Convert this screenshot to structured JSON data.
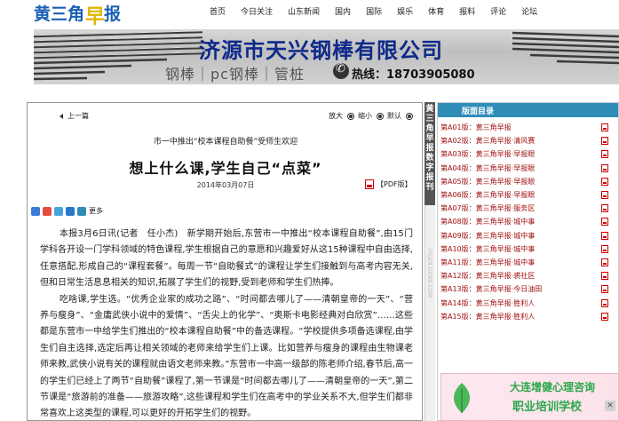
{
  "logo": {
    "part1": "黄三角",
    "mark": "早",
    "part2": "报"
  },
  "nav": [
    "首页",
    "今日关注",
    "山东新闻",
    "国内",
    "国际",
    "娱乐",
    "体育",
    "报料",
    "评论",
    "论坛"
  ],
  "banner": {
    "title": "济源市天兴钢棒有限公司",
    "subtitle": "钢棒｜pc钢棒｜管桩",
    "hotline": "热线：18703905080"
  },
  "article": {
    "prev": "上一篇",
    "zoom_in": "放大",
    "zoom_out": "缩小",
    "default": "默认",
    "kicker": "市一中推出“校本课程自助餐”受师生欢迎",
    "headline": "想上什么课,学生自己“点菜”",
    "date": "2014年03月07日",
    "pdf": "【PDF版】",
    "share_more": "更多",
    "paragraphs": [
      "本报3月6日讯(记者　任小杰)　新学期开始后,东营市一中推出“校本课程自助餐”,由15门学科各开设一门学科领域的特色课程,学生根据自己的意愿和兴趣爱好从这15种课程中自由选择,任意搭配,形成自己的“课程套餐”。每周一节“自助餐式”的课程让学生们接触到与高考内容无关,但和日常生活息息相关的知识,拓展了学生们的视野,受到老师和学生们热捧。",
      "吃啥课,学生选。“优秀企业家的成功之路”、“时间都去哪儿了——清朝皇帝的一天”、“营养与瘦身”、“金庸武侠小说中的爱情”、“舌尖上的化学”、“奥斯卡电影经典对白欣赏”……这些都是东营市一中给学生们推出的“校本课程自助餐”中的备选课程。“学校提供多项备选课程,由学生们自主选择,选定后再让相关领域的老师来给学生们上课。比如营养与瘦身的课程由生物课老师来教,武侠小说有关的课程就由语文老师来教。”东营市一中高一级部的陈老师介绍,春节后,高一的学生们已经上了两节“自助餐”课程了,第一节课是“时间都去哪儿了——清朝皇帝的一天”,第二节课是“旅游前的准备——旅游攻略”,这些课程和学生们在高考中的学业关系不大,但学生们都非常喜欢上这类型的课程,可以更好的开拓学生们的视野。"
    ]
  },
  "vertical_tab": "黄三角早报数字报刊",
  "watermark": "HSJZB.DZWB.COM",
  "sidebar": {
    "title": "版面目录",
    "items": [
      "第A01版：黄三角早报",
      "第A02版：黄三角早报·清风赛",
      "第A03版：黄三角早报·早报眼",
      "第A04版：黄三角早报·早报眼",
      "第A05版：黄三角早报·早报眼",
      "第A06版：黄三角早报·早报眼",
      "第A07版：黄三角早报·服务区",
      "第A08版：黄三角早报·城中事",
      "第A09版：黄三角早报·城中事",
      "第A10版：黄三角早报·城中事",
      "第A11版：黄三角早报·城中事",
      "第A12版：黄三角早报·裘社区",
      "第A13版：黄三角早报·今日油田",
      "第A14版：黄三角早报·胜利人",
      "第A15版：黄三角早报·胜利人"
    ]
  },
  "ad": {
    "line1": "大连增健心理咨询",
    "line2": "职业培训学校",
    "close": "✕"
  }
}
